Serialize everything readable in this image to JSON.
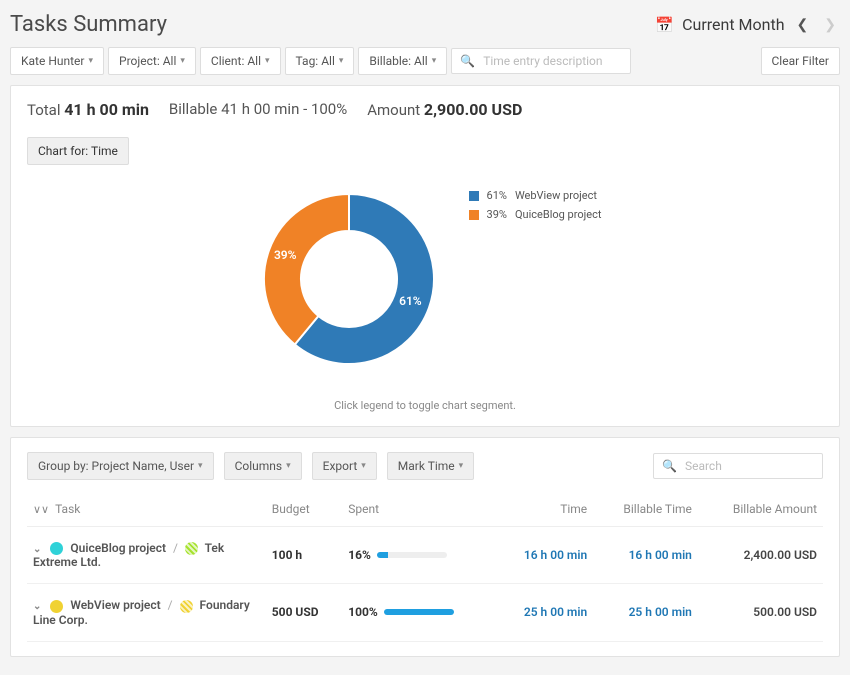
{
  "header": {
    "title": "Tasks Summary",
    "period": "Current Month"
  },
  "filters": {
    "user": "Kate Hunter",
    "project": "Project: All",
    "client": "Client: All",
    "tag": "Tag: All",
    "billable": "Billable: All",
    "search_placeholder": "Time entry description",
    "clear": "Clear Filter"
  },
  "summary": {
    "total_label": "Total",
    "total_value": "41 h 00 min",
    "billable_label": "Billable",
    "billable_value": "41 h 00 min - 100%",
    "amount_label": "Amount",
    "amount_value": "2,900.00 USD"
  },
  "chart_button": "Chart for: Time",
  "chart_caption": "Click legend to toggle chart segment.",
  "chart_data": {
    "type": "pie",
    "series": [
      {
        "name": "WebView project",
        "percent": 61,
        "color": "#2f7ab7"
      },
      {
        "name": "QuiceBlog project",
        "percent": 39,
        "color": "#f08226"
      }
    ],
    "legend": [
      {
        "pct": "61%",
        "label": "WebView project"
      },
      {
        "pct": "39%",
        "label": "QuiceBlog project"
      }
    ],
    "label_a": "61%",
    "label_b": "39%"
  },
  "toolbar": {
    "group_by": "Group by: Project Name, User",
    "columns": "Columns",
    "export": "Export",
    "mark_time": "Mark Time",
    "search_placeholder": "Search"
  },
  "table": {
    "headers": {
      "task": "Task",
      "budget": "Budget",
      "spent": "Spent",
      "time": "Time",
      "billable_time": "Billable Time",
      "billable_amount": "Billable Amount"
    },
    "rows": [
      {
        "project": "QuiceBlog project",
        "project_color": "#2fd2d8",
        "client": "Tek Extreme Ltd.",
        "client_color": "#a6e22e",
        "budget": "100 h",
        "spent_pct": "16%",
        "spent_bar": 16,
        "time": "16 h 00 min",
        "billable_time": "16 h 00 min",
        "billable_amount": "2,400.00 USD"
      },
      {
        "project": "WebView project",
        "project_color": "#f0d233",
        "client": "Foundary Line Corp.",
        "client_color": "#f0d233",
        "budget": "500 USD",
        "spent_pct": "100%",
        "spent_bar": 100,
        "time": "25 h 00 min",
        "billable_time": "25 h 00 min",
        "billable_amount": "500.00 USD"
      }
    ]
  }
}
